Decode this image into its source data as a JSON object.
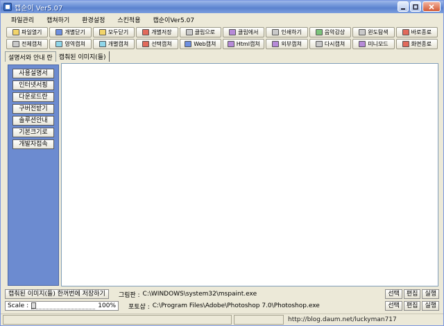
{
  "window": {
    "title": "캡순이 Ver5.07"
  },
  "menu": [
    "파일관리",
    "캡쳐하기",
    "환경설정",
    "스킨적용",
    "캡순이Ver5.07"
  ],
  "toolbar_row1": [
    {
      "label": "파일열기",
      "icon": "folder-open-icon",
      "color": "yellow"
    },
    {
      "label": "개별닫기",
      "icon": "close-window-icon",
      "color": "blue"
    },
    {
      "label": "모두닫기",
      "icon": "close-all-icon",
      "color": "yellow"
    },
    {
      "label": "개별저장",
      "icon": "save-icon",
      "color": "red"
    },
    {
      "label": "클립으로",
      "icon": "clipboard-copy-icon",
      "color": "gray"
    },
    {
      "label": "클립에서",
      "icon": "clipboard-paste-icon",
      "color": "purple"
    },
    {
      "label": "인쇄하기",
      "icon": "printer-icon",
      "color": "gray"
    },
    {
      "label": "음악감상",
      "icon": "music-disc-icon",
      "color": "green"
    },
    {
      "label": "윈도탐색",
      "icon": "explorer-icon",
      "color": "gray"
    },
    {
      "label": "바로종료",
      "icon": "exit-icon",
      "color": "red"
    }
  ],
  "toolbar_row2": [
    {
      "label": "전체캡쳐",
      "icon": "full-screen-capture-icon",
      "color": "gray"
    },
    {
      "label": "영역캡쳐",
      "icon": "region-capture-icon",
      "color": "cyan"
    },
    {
      "label": "개별캡쳐",
      "icon": "window-capture-icon",
      "color": "cyan"
    },
    {
      "label": "선택캡쳐",
      "icon": "selection-capture-icon",
      "color": "red"
    },
    {
      "label": "Web캡쳐",
      "icon": "web-capture-icon",
      "color": "blue"
    },
    {
      "label": "Html캡쳐",
      "icon": "html-capture-icon",
      "color": "purple"
    },
    {
      "label": "외부캡쳐",
      "icon": "external-capture-icon",
      "color": "purple"
    },
    {
      "label": "다시캡쳐",
      "icon": "recapture-icon",
      "color": "gray"
    },
    {
      "label": "미니모드",
      "icon": "mini-mode-icon",
      "color": "purple"
    },
    {
      "label": "화면종료",
      "icon": "screen-exit-icon",
      "color": "red"
    }
  ],
  "tabs": [
    "설명서와 안내 란",
    "캡춰된 이미지(들)"
  ],
  "sidebar": [
    "사용설명서",
    "인터넷서핑",
    "다운로드란",
    "구버전받기",
    "솔루션안내",
    "기본크기로",
    "개발자접속"
  ],
  "status": {
    "save_label": "캡춰된 이미지(들) 한꺼번에 저장하기",
    "paint_label": "그림판 :",
    "paint_path": "C:\\WINDOWS\\system32\\mspaint.exe",
    "photoshop_label": "포토샵 :",
    "photoshop_path": "C:\\Program Files\\Adobe\\Photoshop 7.0\\Photoshop.exe",
    "select_label": "선택",
    "edit_label": "편집",
    "run_label": "실행",
    "scale_label": "Scale :",
    "scale_value": "100%",
    "scale_fraction": 0.0
  },
  "statusbar": {
    "url": "http://blog.daum.net/luckyman717"
  }
}
